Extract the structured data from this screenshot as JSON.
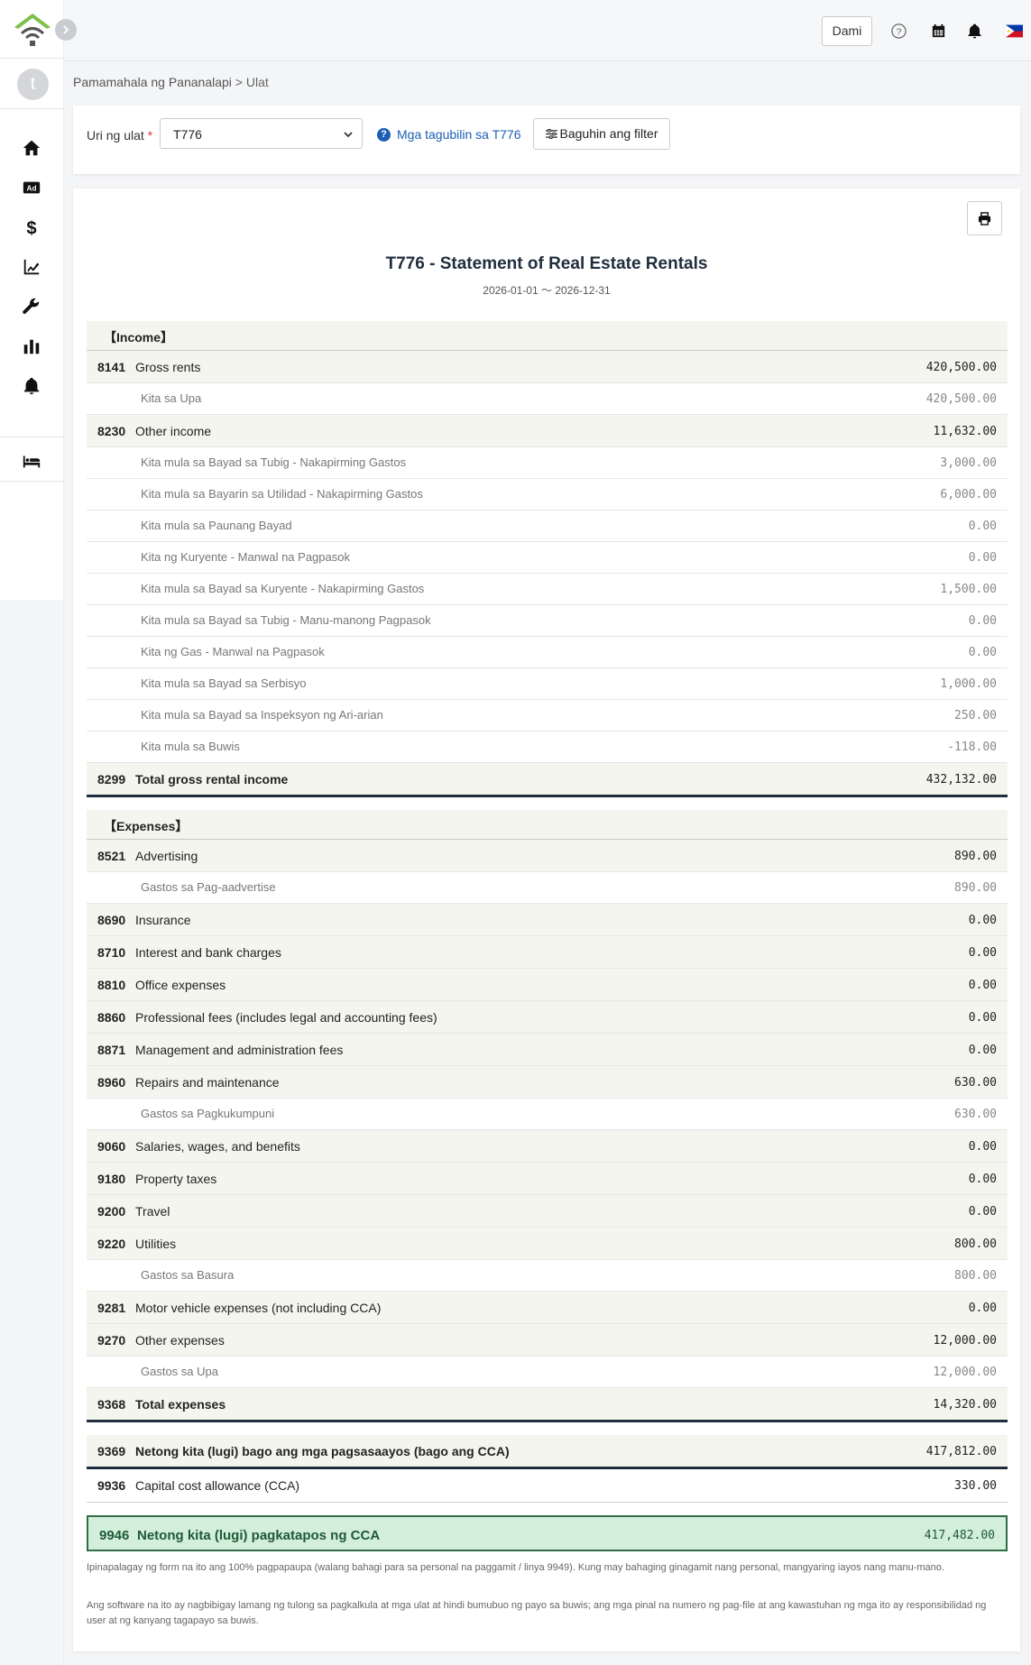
{
  "header": {
    "more_label": "Dami"
  },
  "sidebar": {
    "avatar_initial": "t",
    "items": [
      {
        "icon": "home-icon"
      },
      {
        "icon": "ad-icon",
        "text": "Ad"
      },
      {
        "icon": "dollar-icon"
      },
      {
        "icon": "chart-edit-icon"
      },
      {
        "icon": "wrench-icon"
      },
      {
        "icon": "bar-chart-icon"
      },
      {
        "icon": "bell-icon"
      },
      {
        "icon": "bed-icon"
      }
    ]
  },
  "breadcrumb": {
    "parent": "Pamamahala ng Pananalapi",
    "separator": ">",
    "current": "Ulat"
  },
  "filter": {
    "label": "Uri ng ulat",
    "required_mark": "*",
    "selected": "T776",
    "help_text": "Mga tagubilin sa T776",
    "filter_button": "Baguhin ang filter"
  },
  "report": {
    "title": "T776 - Statement of Real Estate Rentals",
    "dates": "2026-01-01 〜 2026-12-31",
    "rows": [
      {
        "type": "section",
        "label": "【Income】"
      },
      {
        "type": "acct",
        "code": "8141",
        "label": "Gross rents",
        "amount": "420,500.00"
      },
      {
        "type": "sub",
        "label": "Kita sa Upa",
        "amount": "420,500.00"
      },
      {
        "type": "acct",
        "code": "8230",
        "label": "Other income",
        "amount": "11,632.00"
      },
      {
        "type": "sub",
        "label": "Kita mula sa Bayad sa Tubig - Nakapirming Gastos",
        "amount": "3,000.00"
      },
      {
        "type": "sub",
        "label": "Kita mula sa Bayarin sa Utilidad - Nakapirming Gastos",
        "amount": "6,000.00"
      },
      {
        "type": "sub",
        "label": "Kita mula sa Paunang Bayad",
        "amount": "0.00"
      },
      {
        "type": "sub",
        "label": "Kita ng Kuryente - Manwal na Pagpasok",
        "amount": "0.00"
      },
      {
        "type": "sub",
        "label": "Kita mula sa Bayad sa Kuryente - Nakapirming Gastos",
        "amount": "1,500.00"
      },
      {
        "type": "sub",
        "label": "Kita mula sa Bayad sa Tubig - Manu-manong Pagpasok",
        "amount": "0.00"
      },
      {
        "type": "sub",
        "label": "Kita ng Gas - Manwal na Pagpasok",
        "amount": "0.00"
      },
      {
        "type": "sub",
        "label": "Kita mula sa Bayad sa Serbisyo",
        "amount": "1,000.00"
      },
      {
        "type": "sub",
        "label": "Kita mula sa Bayad sa Inspeksyon ng Ari-arian",
        "amount": "250.00"
      },
      {
        "type": "sub",
        "label": "Kita mula sa Buwis",
        "amount": "-118.00"
      },
      {
        "type": "total",
        "code": "8299",
        "label": "Total gross rental income",
        "amount": "432,132.00"
      },
      {
        "type": "section",
        "label": "【Expenses】"
      },
      {
        "type": "acct",
        "code": "8521",
        "label": "Advertising",
        "amount": "890.00"
      },
      {
        "type": "sub",
        "label": "Gastos sa Pag-aadvertise",
        "amount": "890.00"
      },
      {
        "type": "acct",
        "code": "8690",
        "label": "Insurance",
        "amount": "0.00"
      },
      {
        "type": "acct",
        "code": "8710",
        "label": "Interest and bank charges",
        "amount": "0.00"
      },
      {
        "type": "acct",
        "code": "8810",
        "label": "Office expenses",
        "amount": "0.00"
      },
      {
        "type": "acct",
        "code": "8860",
        "label": "Professional fees (includes legal and accounting fees)",
        "amount": "0.00"
      },
      {
        "type": "acct",
        "code": "8871",
        "label": "Management and administration fees",
        "amount": "0.00"
      },
      {
        "type": "acct",
        "code": "8960",
        "label": "Repairs and maintenance",
        "amount": "630.00"
      },
      {
        "type": "sub",
        "label": "Gastos sa Pagkukumpuni",
        "amount": "630.00"
      },
      {
        "type": "acct",
        "code": "9060",
        "label": "Salaries, wages, and benefits",
        "amount": "0.00"
      },
      {
        "type": "acct",
        "code": "9180",
        "label": "Property taxes",
        "amount": "0.00"
      },
      {
        "type": "acct",
        "code": "9200",
        "label": "Travel",
        "amount": "0.00"
      },
      {
        "type": "acct",
        "code": "9220",
        "label": "Utilities",
        "amount": "800.00"
      },
      {
        "type": "sub",
        "label": "Gastos sa Basura",
        "amount": "800.00"
      },
      {
        "type": "acct",
        "code": "9281",
        "label": "Motor vehicle expenses (not including CCA)",
        "amount": "0.00"
      },
      {
        "type": "acct",
        "code": "9270",
        "label": "Other expenses",
        "amount": "12,000.00"
      },
      {
        "type": "sub",
        "label": "Gastos sa Upa",
        "amount": "12,000.00"
      },
      {
        "type": "total",
        "code": "9368",
        "label": "Total expenses",
        "amount": "14,320.00"
      },
      {
        "type": "net",
        "code": "9369",
        "label": "Netong kita (lugi) bago ang mga pagsasaayos (bago ang CCA)",
        "amount": "417,812.00"
      },
      {
        "type": "cca",
        "code": "9936",
        "label": "Capital cost allowance (CCA)",
        "amount": "330.00"
      },
      {
        "type": "final",
        "code": "9946",
        "label": "Netong kita (lugi) pagkatapos ng CCA",
        "amount": "417,482.00"
      }
    ],
    "note1": "Ipinapalagay ng form na ito ang 100% pagpapaupa (walang bahagi para sa personal na paggamit / linya 9949). Kung may bahaging ginagamit nang personal, mangyaring iayos nang manu-mano.",
    "note2": "Ang software na ito ay nagbibigay lamang ng tulong sa pagkalkula at mga ulat at hindi bumubuo ng payo sa buwis; ang mga pinal na numero ng pag-file at ang kawastuhan ng mga ito ay responsibilidad ng user at ng kanyang tagapayo sa buwis."
  }
}
